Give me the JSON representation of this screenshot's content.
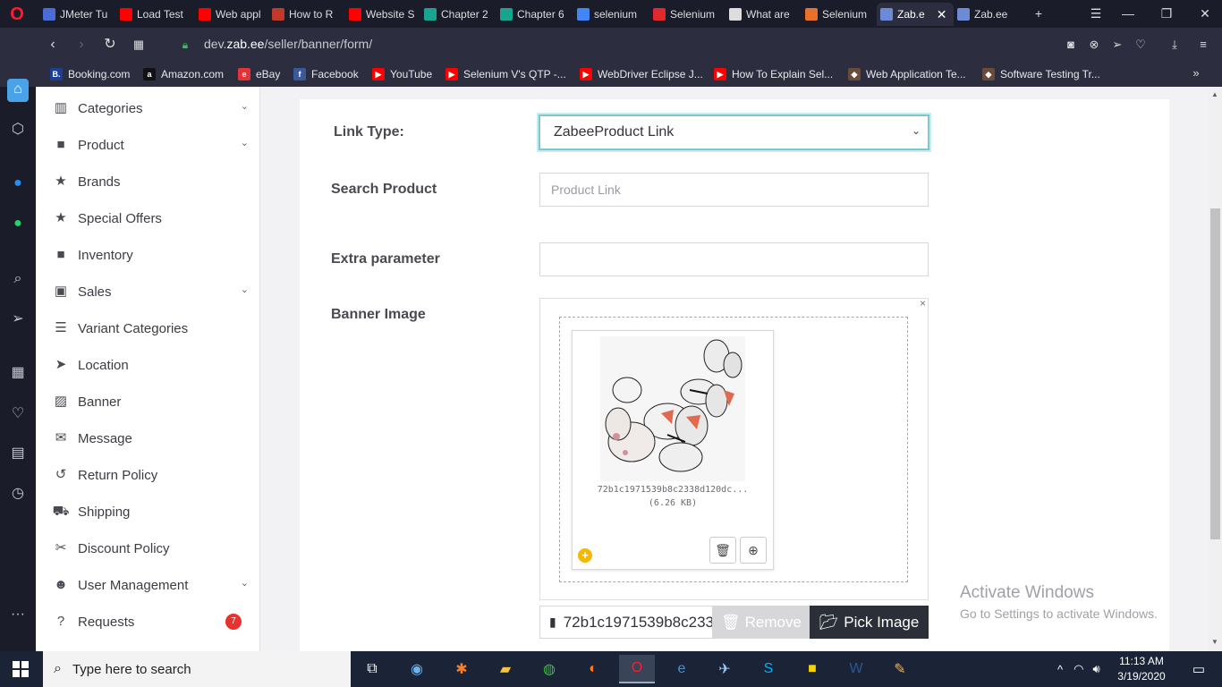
{
  "browser": {
    "tabs": [
      {
        "label": "JMeter Tu",
        "icon": "jmeter-icon",
        "color": "#4a6cd4"
      },
      {
        "label": "Load Test",
        "icon": "youtube-icon",
        "color": "#ff0000"
      },
      {
        "label": "Web appl",
        "icon": "youtube-icon",
        "color": "#ff0000"
      },
      {
        "label": "How to R",
        "icon": "b-icon",
        "color": "#c0392b"
      },
      {
        "label": "Website S",
        "icon": "youtube-icon",
        "color": "#ff0000"
      },
      {
        "label": "Chapter 2",
        "icon": "t4u-icon",
        "color": "#1aa38f"
      },
      {
        "label": "Chapter 6",
        "icon": "t4u-icon",
        "color": "#1aa38f"
      },
      {
        "label": "selenium",
        "icon": "google-icon",
        "color": "#4285f4"
      },
      {
        "label": "Selenium",
        "icon": "v-icon",
        "color": "#e0282e"
      },
      {
        "label": "What are",
        "icon": "gear-icon",
        "color": "#dddddd"
      },
      {
        "label": "Selenium",
        "icon": "g-icon",
        "color": "#e8702a"
      },
      {
        "label": "Zab.e",
        "icon": "zab-icon",
        "color": "#6b8bd6",
        "active": true
      },
      {
        "label": "Zab.ee",
        "icon": "zab-icon",
        "color": "#6b8bd6"
      }
    ],
    "url_prefix": "dev.",
    "url_domain": "zab.ee",
    "url_path": "/seller/banner/form/",
    "bookmarks": [
      {
        "label": "Booking.com",
        "icon": "booking-icon",
        "color": "#1c3f94",
        "glyph": "B."
      },
      {
        "label": "Amazon.com",
        "icon": "amazon-icon",
        "color": "#111111",
        "glyph": "a"
      },
      {
        "label": "eBay",
        "icon": "ebay-icon",
        "color": "#e53238",
        "glyph": "e"
      },
      {
        "label": "Facebook",
        "icon": "facebook-icon",
        "color": "#3b5998",
        "glyph": "f"
      },
      {
        "label": "YouTube",
        "icon": "youtube-icon",
        "color": "#ff0000",
        "glyph": "▶"
      },
      {
        "label": "Selenium V's QTP -...",
        "icon": "youtube-icon",
        "color": "#ff0000",
        "glyph": "▶"
      },
      {
        "label": "WebDriver Eclipse J...",
        "icon": "youtube-icon",
        "color": "#ff0000",
        "glyph": "▶"
      },
      {
        "label": "How To Explain Sel...",
        "icon": "youtube-icon",
        "color": "#ff0000",
        "glyph": "▶"
      },
      {
        "label": "Web Application Te...",
        "icon": "cube-icon",
        "color": "#6a4a3a",
        "glyph": "◆"
      },
      {
        "label": "Software Testing Tr...",
        "icon": "cube-icon",
        "color": "#6a4a3a",
        "glyph": "◆"
      }
    ]
  },
  "nav": {
    "items": [
      {
        "label": "Categories",
        "icon": "bar-chart-icon",
        "glyph": "▥",
        "chevron": true
      },
      {
        "label": "Product",
        "icon": "briefcase-icon",
        "glyph": "■",
        "chevron": true
      },
      {
        "label": "Brands",
        "icon": "star-icon",
        "glyph": "★",
        "chevron": false
      },
      {
        "label": "Special Offers",
        "icon": "star-icon",
        "glyph": "★",
        "chevron": false
      },
      {
        "label": "Inventory",
        "icon": "briefcase-icon",
        "glyph": "■",
        "chevron": false
      },
      {
        "label": "Sales",
        "icon": "money-icon",
        "glyph": "▣",
        "chevron": true
      },
      {
        "label": "Variant Categories",
        "icon": "list-icon",
        "glyph": "☰",
        "chevron": false
      },
      {
        "label": "Location",
        "icon": "location-arrow-icon",
        "glyph": "➤",
        "chevron": false
      },
      {
        "label": "Banner",
        "icon": "image-icon",
        "glyph": "▨",
        "chevron": false
      },
      {
        "label": "Message",
        "icon": "envelope-icon",
        "glyph": "✉",
        "chevron": false
      },
      {
        "label": "Return Policy",
        "icon": "undo-icon",
        "glyph": "↺",
        "chevron": false
      },
      {
        "label": "Shipping",
        "icon": "truck-icon",
        "glyph": "⛟",
        "chevron": false
      },
      {
        "label": "Discount Policy",
        "icon": "scissors-icon",
        "glyph": "✂",
        "chevron": false
      },
      {
        "label": "User Management",
        "icon": "users-icon",
        "glyph": "☻",
        "chevron": true
      },
      {
        "label": "Requests",
        "icon": "question-circle-icon",
        "glyph": "?",
        "chevron": false,
        "badge": "7"
      }
    ]
  },
  "form": {
    "link_type_label": "Link Type:",
    "link_type_value": "ZabeeProduct Link",
    "search_product_label": "Search Product",
    "search_product_placeholder": "Product Link",
    "extra_parameter_label": "Extra parameter",
    "extra_parameter_value": "",
    "banner_image_label": "Banner Image",
    "file_caption": "72b1c1971539b8c2338d120dc...",
    "file_size": "(6.26 KB)",
    "file_name_field": "72b1c1971539b8c233",
    "remove_label": "Remove",
    "pick_image_label": "Pick Image"
  },
  "watermark": {
    "line1": "Activate Windows",
    "line2": "Go to Settings to activate Windows."
  },
  "taskbar": {
    "search_placeholder": "Type here to search",
    "time": "11:13 AM",
    "date": "3/19/2020"
  },
  "colors": {
    "accent_border": "#7fc7cf",
    "pick_button": "#2b3038",
    "badge": "#e8322e",
    "add_icon": "#f5b800"
  }
}
